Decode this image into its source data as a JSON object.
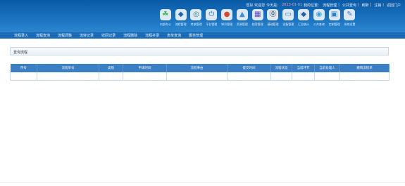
{
  "topbar": {
    "items": [
      "您好 欢迎您",
      "今天是：",
      "2013-01-01",
      "我的位置：",
      "流程管理",
      "公共查询",
      "刷新",
      "注销",
      "返回门户"
    ]
  },
  "toolbar": [
    {
      "label": "内部办公",
      "icon": "office-icon",
      "glyph": "☘",
      "color": "#3fb34a"
    },
    {
      "label": "流程管理",
      "icon": "flow-icon",
      "glyph": "◆",
      "color": "#1f5fa8"
    },
    {
      "label": "考核管理",
      "icon": "assess-icon",
      "glyph": "◎",
      "color": "#2c8a5e"
    },
    {
      "label": "平台管理",
      "icon": "power-icon",
      "glyph": "⏻",
      "color": "#2c6fb0"
    },
    {
      "label": "知识管理",
      "icon": "knowledge-icon",
      "glyph": "●",
      "color": "#d34a2b"
    },
    {
      "label": "资源管理",
      "icon": "resource-icon",
      "glyph": "▲",
      "color": "#3e8ed0"
    },
    {
      "label": "档案管理",
      "icon": "archive-icon",
      "glyph": "▦",
      "color": "#5a48b0"
    },
    {
      "label": "基础管理",
      "icon": "base-icon",
      "glyph": "⓪",
      "color": "#2a2a2a"
    },
    {
      "label": "设备管理",
      "icon": "device-icon",
      "glyph": "▭",
      "color": "#2b7bc6"
    },
    {
      "label": "汇总统计",
      "icon": "stats-icon",
      "glyph": "◆",
      "color": "#1f5fa8"
    },
    {
      "label": "公共查询",
      "icon": "query-icon",
      "glyph": "◉",
      "color": "#3aa0d6"
    },
    {
      "label": "定制管理",
      "icon": "custom-icon",
      "glyph": "▣",
      "color": "#2e7cc2"
    },
    {
      "label": "系统设置",
      "icon": "settings-icon",
      "glyph": "✎",
      "color": "#4a78b5"
    }
  ],
  "menu": [
    "流程录入",
    "流程查询",
    "流程调整",
    "流转记录",
    "收回记录",
    "流程删除",
    "流程补录",
    "表单查询",
    "服务管理"
  ],
  "panel": {
    "title": "查询流程"
  },
  "table": {
    "columns": [
      "序号",
      "流程单号",
      "类别",
      "申请时间",
      "流程事由",
      "提交时间",
      "流程状态",
      "当前环节",
      "当前处理人",
      "撤销流程单"
    ]
  }
}
